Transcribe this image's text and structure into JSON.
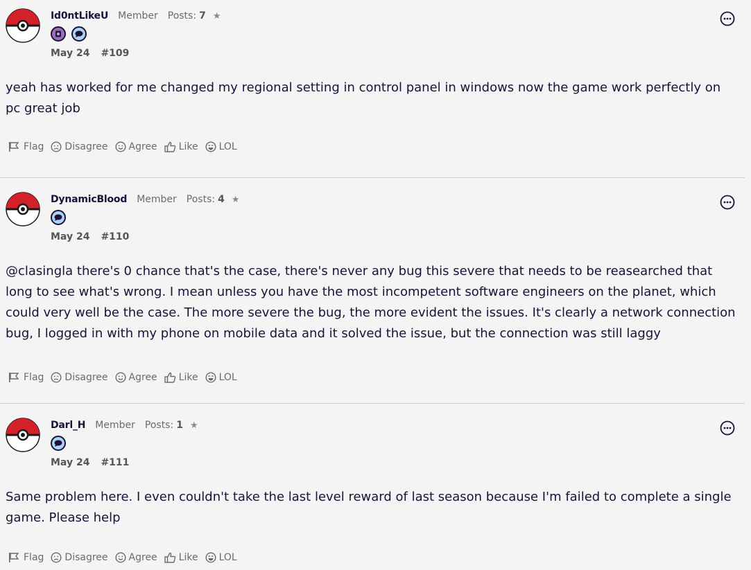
{
  "posts": [
    {
      "author": "Id0ntLikeU",
      "role": "Member",
      "posts_label": "Posts:",
      "posts_count": "7",
      "badges": [
        "first-post-badge",
        "comment-badge"
      ],
      "date": "May 24",
      "number": "#109",
      "body": "yeah has worked for me changed my regional setting in control panel in windows now the game work perfectly on pc great job"
    },
    {
      "author": "DynamicBlood",
      "role": "Member",
      "posts_label": "Posts:",
      "posts_count": "4",
      "badges": [
        "comment-badge"
      ],
      "date": "May 24",
      "number": "#110",
      "body": "@clasingla there's 0 chance that's the case, there's never any bug this severe that needs to be reasearched that long to see what's wrong. I mean unless you have the most incompetent software engineers on the planet, which could very well be the case. The more severe the bug, the more evident the issues. It's clearly a network connection bug, I logged in with my phone on mobile data and it solved the issue, but the connection was still laggy"
    },
    {
      "author": "Darl_H",
      "role": "Member",
      "posts_label": "Posts:",
      "posts_count": "1",
      "badges": [
        "comment-badge"
      ],
      "date": "May 24",
      "number": "#111",
      "body": "Same problem here. I even couldn't take the last level reward of last season because I'm failed to complete a single game. Please help"
    }
  ],
  "reactions": {
    "flag": "Flag",
    "disagree": "Disagree",
    "agree": "Agree",
    "like": "Like",
    "lol": "LOL"
  },
  "icons": {
    "star": "star-icon",
    "options": "options-icon",
    "avatar": "pokeball-avatar"
  },
  "colors": {
    "text": "#1a1238",
    "muted": "#6b6b6b",
    "pokeball_red": "#d3202a",
    "badge_blue": "#aad4f2",
    "badge_purple": "#9b6dbd"
  }
}
